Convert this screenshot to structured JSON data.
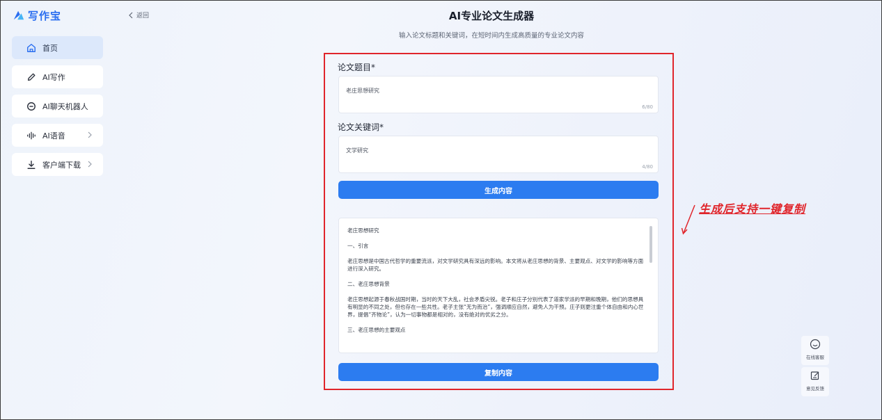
{
  "app": {
    "name": "写作宝",
    "brand_color": "#2a6ef0"
  },
  "sidebar": {
    "items": [
      {
        "label": "首页",
        "icon": "home-icon",
        "active": true
      },
      {
        "label": "AI写作",
        "icon": "pen-icon"
      },
      {
        "label": "AI聊天机器人",
        "icon": "chat-icon"
      },
      {
        "label": "AI语音",
        "icon": "sound-wave-icon",
        "has_submenu": true
      },
      {
        "label": "客户端下载",
        "icon": "download-icon",
        "has_submenu": true
      }
    ]
  },
  "header": {
    "back_label": "返回",
    "title": "AI专业论文生成器",
    "subtitle": "输入论文标题和关键词，在短时间内生成高质量的专业论文内容"
  },
  "form": {
    "title_label": "论文题目*",
    "title_value": "老庄思想研究",
    "title_count": "6/80",
    "keywords_label": "论文关键词*",
    "keywords_value": "文学研究",
    "keywords_count": "4/80",
    "generate_label": "生成内容",
    "copy_label": "复制内容"
  },
  "output": {
    "paragraphs": [
      "老庄思想研究",
      "一、引言",
      "老庄思想是中国古代哲学的重要流派，对文学研究具有深远的影响。本文将从老庄思想的背景、主要观点、对文学的影响等方面进行深入研究。",
      "二、老庄思想背景",
      "老庄思想起源于春秋战国时期，当时的天下大乱，社会矛盾尖锐。老子和庄子分别代表了道家学派的早期和晚期，他们的思想具有明显的不同之处，但也存在一些共性。老子主张“无为而治”，强调顺应自然，避免人为干预。庄子则更注重个体自由和内心世界，提倡“齐物论”，认为一切事物都是相对的，没有绝对的优劣之分。",
      "三、老庄思想的主要观点"
    ]
  },
  "annotation": {
    "text": "生成后支持一键复制",
    "color": "#e0252b"
  },
  "floating": {
    "service_label": "在线客服",
    "feedback_label": "意见反馈"
  },
  "colors": {
    "primary_button": "#2c7cf0",
    "highlight_border": "#e0252b",
    "active_nav": "#dce8fb"
  }
}
